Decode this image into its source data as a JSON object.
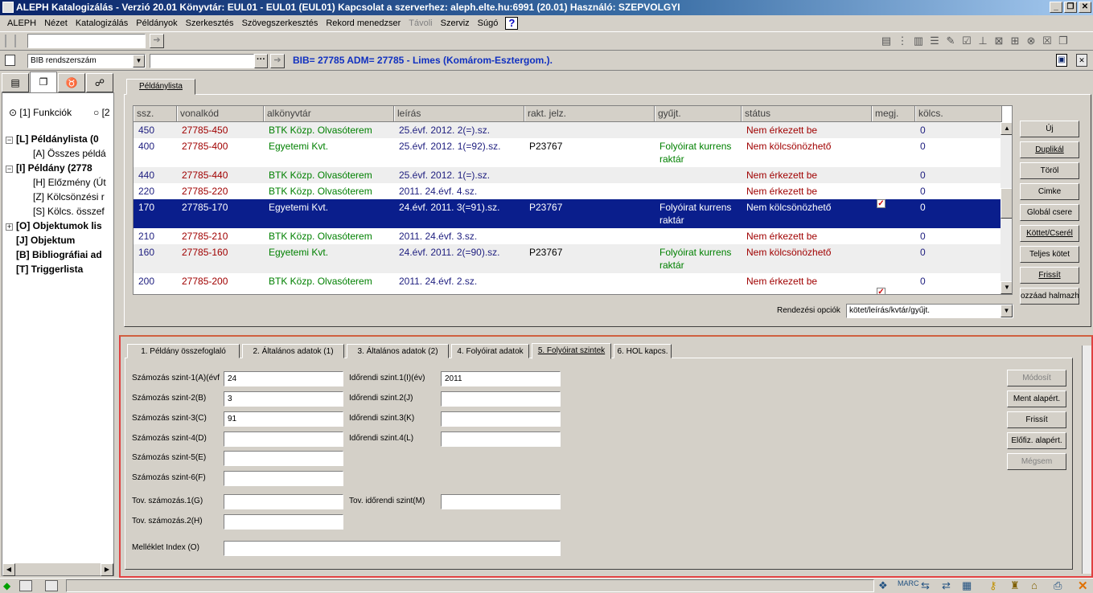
{
  "window": {
    "title": "ALEPH Katalogizálás - Verzió 20.01  Könyvtár:  EUL01 - EUL01 (EUL01)  Kapcsolat a szerverhez:  aleph.elte.hu:6991 (20.01)  Használó:  SZEPVOLGYI"
  },
  "menu": [
    "ALEPH",
    "Nézet",
    "Katalogizálás",
    "Példányok",
    "Szerkesztés",
    "Szövegszerkesztés",
    "Rekord menedzser",
    "Távoli",
    "Szerviz",
    "Súgó"
  ],
  "search": {
    "select_value": "BIB rendszerszám",
    "bib_line": "BIB= 27785 ADM= 27785 - Limes (Komárom-Esztergom.)."
  },
  "left": {
    "radio1": "[1] Funkciók",
    "radio2": "[2",
    "tree": [
      {
        "label": "[L] Példánylista (0",
        "bold": true,
        "level": 0,
        "toggle": "−"
      },
      {
        "label": "[A] Összes példá",
        "bold": false,
        "level": 1
      },
      {
        "label": "[I] Példány (2778",
        "bold": true,
        "level": 0,
        "toggle": "−"
      },
      {
        "label": "[H] Előzmény (Út",
        "bold": false,
        "level": 1
      },
      {
        "label": "[Z] Kölcsönzési r",
        "bold": false,
        "level": 1
      },
      {
        "label": "[S] Kölcs. összef",
        "bold": false,
        "level": 1
      },
      {
        "label": "[O] Objektumok lis",
        "bold": true,
        "level": 0,
        "toggle": "+"
      },
      {
        "label": "[J] Objektum",
        "bold": true,
        "level": 0
      },
      {
        "label": "[B] Bibliográfiai ad",
        "bold": true,
        "level": 0
      },
      {
        "label": "[T] Triggerlista",
        "bold": true,
        "level": 0
      }
    ]
  },
  "list": {
    "tab": "Példánylista",
    "columns": [
      "ssz.",
      "vonalkód",
      "alkönyvtár",
      "leírás",
      "rakt. jelz.",
      "gyűjt.",
      "státus",
      "megj.",
      "kölcs."
    ],
    "rows": [
      {
        "ssz": "450",
        "barcode": "27785-450",
        "sub": "BTK Közp. Olvasóterem",
        "desc": "25.évf. 2012. 2(=).sz.",
        "call": "",
        "coll": "",
        "coll2": "",
        "status": "Nem érkezett be",
        "note": false,
        "loan": "0",
        "selected": false
      },
      {
        "ssz": "400",
        "barcode": "27785-400",
        "sub": "Egyetemi Kvt.",
        "desc": "25.évf. 2012. 1(=92).sz.",
        "call": "P23767",
        "coll": "Folyóirat kurrens",
        "coll2": "raktár",
        "status": "Nem kölcsönözhető",
        "note": false,
        "loan": "0",
        "selected": false
      },
      {
        "ssz": "440",
        "barcode": "27785-440",
        "sub": "BTK Közp. Olvasóterem",
        "desc": "25.évf. 2012. 1(=).sz.",
        "call": "",
        "coll": "",
        "coll2": "",
        "status": "Nem érkezett be",
        "note": false,
        "loan": "0",
        "selected": false
      },
      {
        "ssz": "220",
        "barcode": "27785-220",
        "sub": "BTK Közp. Olvasóterem",
        "desc": "2011. 24.évf. 4.sz.",
        "call": "",
        "coll": "",
        "coll2": "",
        "status": "Nem érkezett be",
        "note": false,
        "loan": "0",
        "selected": false
      },
      {
        "ssz": "170",
        "barcode": "27785-170",
        "sub": "Egyetemi Kvt.",
        "desc": "24.évf. 2011. 3(=91).sz.",
        "call": "P23767",
        "coll": "Folyóirat kurrens",
        "coll2": "raktár",
        "status": "Nem kölcsönözhető",
        "note": true,
        "loan": "0",
        "selected": true
      },
      {
        "ssz": "210",
        "barcode": "27785-210",
        "sub": "BTK Közp. Olvasóterem",
        "desc": "2011. 24.évf. 3.sz.",
        "call": "",
        "coll": "",
        "coll2": "",
        "status": "Nem érkezett be",
        "note": false,
        "loan": "0",
        "selected": false
      },
      {
        "ssz": "160",
        "barcode": "27785-160",
        "sub": "Egyetemi Kvt.",
        "desc": "24.évf. 2011. 2(=90).sz.",
        "call": "P23767",
        "coll": "Folyóirat kurrens",
        "coll2": "raktár",
        "status": "Nem kölcsönözhető",
        "note": false,
        "loan": "0",
        "selected": false
      },
      {
        "ssz": "200",
        "barcode": "27785-200",
        "sub": "BTK Közp. Olvasóterem",
        "desc": "2011. 24.évf. 2.sz.",
        "call": "",
        "coll": "",
        "coll2": "",
        "status": "Nem érkezett be",
        "note": true,
        "loan": "0",
        "selected": false
      }
    ],
    "buttons": [
      "Új",
      "Duplikál",
      "Töröl",
      "Cimke",
      "Globál csere",
      "Köttet/Cserél",
      "Teljes kötet",
      "Frissít",
      "ozzáad halmazho"
    ],
    "sort_label": "Rendezési opciók",
    "sort_value": "kötet/leírás/kvtár/gyűjt."
  },
  "detail": {
    "tabs": [
      "1. Példány összefoglaló",
      "2. Általános adatok (1)",
      "3. Általános adatok (2)",
      "4. Folyóirat adatok",
      "5. Folyóirat szintek",
      "6. HOL kapcs."
    ],
    "left_fields": [
      {
        "label": "Számozás szint-1(A)(évf",
        "value": "24"
      },
      {
        "label": "Számozás szint-2(B)",
        "value": "3"
      },
      {
        "label": "Számozás szint-3(C)",
        "value": "91"
      },
      {
        "label": "Számozás szint-4(D)",
        "value": ""
      },
      {
        "label": "Számozás szint-5(E)",
        "value": ""
      },
      {
        "label": "Számozás szint-6(F)",
        "value": ""
      }
    ],
    "right_fields": [
      {
        "label": "Időrendi szint.1(I)(év)",
        "value": "2011"
      },
      {
        "label": "Időrendi szint.2(J)",
        "value": ""
      },
      {
        "label": "Időrendi szint.3(K)",
        "value": ""
      },
      {
        "label": "Időrendi szint.4(L)",
        "value": ""
      }
    ],
    "tov1": {
      "label": "Tov. számozás.1(G)",
      "value": ""
    },
    "tov2": {
      "label": "Tov. számozás.2(H)",
      "value": ""
    },
    "tov_time": {
      "label": "Tov. időrendi szint(M)",
      "value": ""
    },
    "index": {
      "label": "Melléklet Index (O)",
      "value": ""
    },
    "buttons": [
      "Módosít",
      "Ment alapért.",
      "Frissít",
      "Előfiz. alapért.",
      "Mégsem"
    ]
  },
  "colors": {
    "selected_row": "#0a1e8c",
    "status_red": "#a00000",
    "sub_green": "#008000",
    "desc_blue": "#202080"
  }
}
